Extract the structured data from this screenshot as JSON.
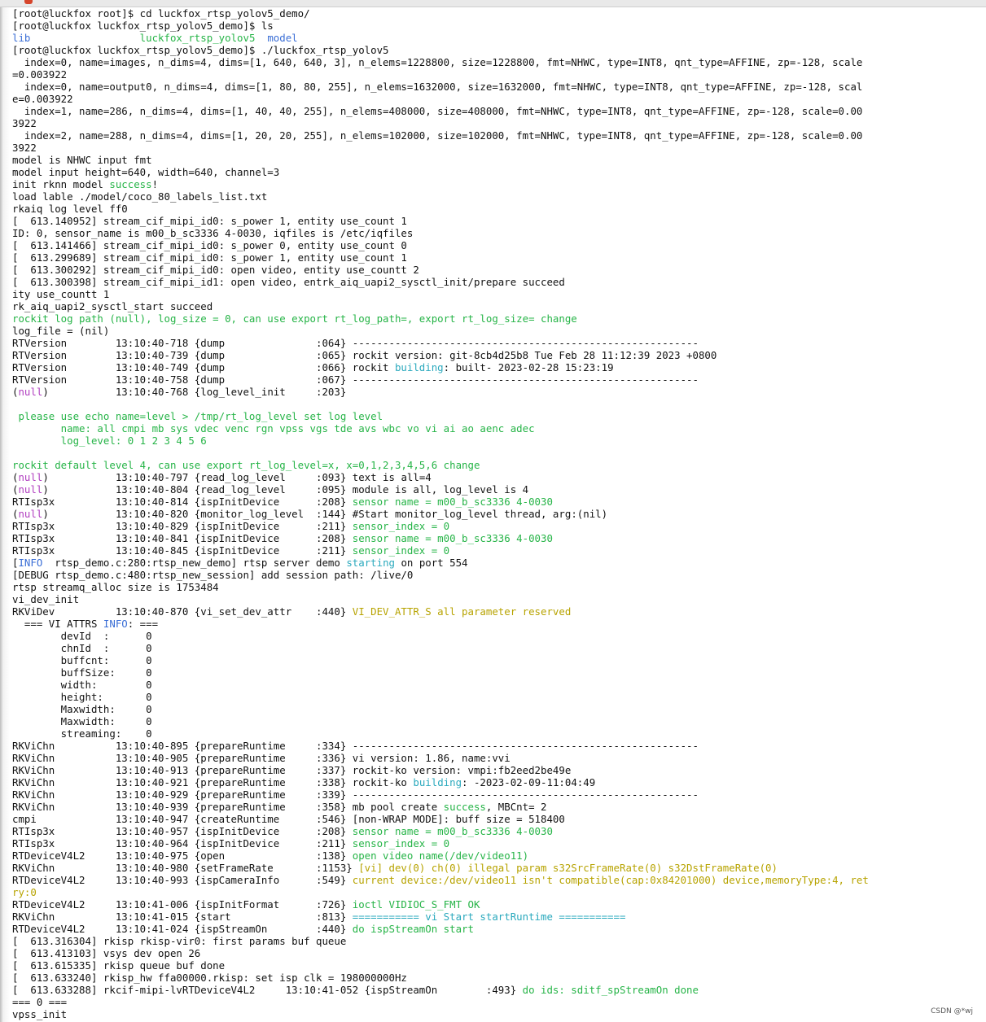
{
  "colors": {
    "cyan": "#2aa9bd",
    "green": "#26b447",
    "magenta": "#b13fc0",
    "yellow": "#b7a300",
    "blue": "#3a6ed6",
    "default": "#111111"
  },
  "terminal": {
    "lines": [
      [
        {
          "t": "[root@luckfox root]$ cd luckfox_rtsp_yolov5_demo/"
        }
      ],
      [
        {
          "t": "[root@luckfox luckfox_rtsp_yolov5_demo]$ ls"
        }
      ],
      [
        {
          "t": "lib",
          "c": "blue"
        },
        {
          "t": "                  "
        },
        {
          "t": "luckfox_rtsp_yolov5",
          "c": "green"
        },
        {
          "t": "  "
        },
        {
          "t": "model",
          "c": "blue"
        }
      ],
      [
        {
          "t": "[root@luckfox luckfox_rtsp_yolov5_demo]$ ./luckfox_rtsp_yolov5"
        }
      ],
      [
        {
          "t": "  index=0, name=images, n_dims=4, dims=[1, 640, 640, 3], n_elems=1228800, size=1228800, fmt=NHWC, type=INT8, qnt_type=AFFINE, zp=-128, scale"
        }
      ],
      [
        {
          "t": "=0.003922"
        }
      ],
      [
        {
          "t": "  index=0, name=output0, n_dims=4, dims=[1, 80, 80, 255], n_elems=1632000, size=1632000, fmt=NHWC, type=INT8, qnt_type=AFFINE, zp=-128, scal"
        }
      ],
      [
        {
          "t": "e=0.003922"
        }
      ],
      [
        {
          "t": "  index=1, name=286, n_dims=4, dims=[1, 40, 40, 255], n_elems=408000, size=408000, fmt=NHWC, type=INT8, qnt_type=AFFINE, zp=-128, scale=0.00"
        }
      ],
      [
        {
          "t": "3922"
        }
      ],
      [
        {
          "t": "  index=2, name=288, n_dims=4, dims=[1, 20, 20, 255], n_elems=102000, size=102000, fmt=NHWC, type=INT8, qnt_type=AFFINE, zp=-128, scale=0.00"
        }
      ],
      [
        {
          "t": "3922"
        }
      ],
      [
        {
          "t": "model is NHWC input fmt"
        }
      ],
      [
        {
          "t": "model input height=640, width=640, channel=3"
        }
      ],
      [
        {
          "t": "init rknn model "
        },
        {
          "t": "success",
          "c": "green"
        },
        {
          "t": "!"
        }
      ],
      [
        {
          "t": "load lable ./model/coco_80_labels_list.txt"
        }
      ],
      [
        {
          "t": "rkaiq log level ff0"
        }
      ],
      [
        {
          "t": "[  613.140952] stream_cif_mipi_id0: s_power 1, entity use_count 1"
        }
      ],
      [
        {
          "t": "ID: 0, sensor_name is m00_b_sc3336 4-0030, iqfiles is /etc/iqfiles"
        }
      ],
      [
        {
          "t": "[  613.141466] stream_cif_mipi_id0: s_power 0, entity use_count 0"
        }
      ],
      [
        {
          "t": "[  613.299689] stream_cif_mipi_id0: s_power 1, entity use_count 1"
        }
      ],
      [
        {
          "t": "[  613.300292] stream_cif_mipi_id0: open video, entity use_countt 2"
        }
      ],
      [
        {
          "t": "[  613.300398] stream_cif_mipi_id1: open video, entrk_aiq_uapi2_sysctl_init/prepare succeed"
        }
      ],
      [
        {
          "t": "ity use_countt 1"
        }
      ],
      [
        {
          "t": "rk_aiq_uapi2_sysctl_start succeed"
        }
      ],
      [
        {
          "t": "rockit log path (null), log_size = 0, can use export rt_log_path=, export rt_log_size= change",
          "c": "green"
        }
      ],
      [
        {
          "t": "log_file = (nil)"
        }
      ],
      [
        {
          "t": "RTVersion        13:10:40-718 {dump               :064} ---------------------------------------------------------"
        }
      ],
      [
        {
          "t": "RTVersion        13:10:40-739 {dump               :065} rockit version: git-8cb4d25b8 Tue Feb 28 11:12:39 2023 +0800"
        }
      ],
      [
        {
          "t": "RTVersion        13:10:40-749 {dump               :066} rockit "
        },
        {
          "t": "building",
          "c": "cyan"
        },
        {
          "t": ": built- 2023-02-28 15:23:19"
        }
      ],
      [
        {
          "t": "RTVersion        13:10:40-758 {dump               :067} ---------------------------------------------------------"
        }
      ],
      [
        {
          "t": "("
        },
        {
          "t": "null",
          "c": "magenta"
        },
        {
          "t": ")           13:10:40-768 {log_level_init     :203}"
        }
      ],
      [
        {
          "t": ""
        }
      ],
      [
        {
          "t": " please use echo name=level > /tmp/rt_log_level set log level",
          "c": "green"
        }
      ],
      [
        {
          "t": "        name: all cmpi mb sys vdec venc rgn vpss vgs tde avs wbc vo vi ai ao aenc adec",
          "c": "green"
        }
      ],
      [
        {
          "t": "        log_level: 0 1 2 3 4 5 6",
          "c": "green"
        }
      ],
      [
        {
          "t": ""
        }
      ],
      [
        {
          "t": "rockit default level 4, can use export rt_log_level=x, x=0,1,2,3,4,5,6 change",
          "c": "green"
        }
      ],
      [
        {
          "t": "("
        },
        {
          "t": "null",
          "c": "magenta"
        },
        {
          "t": ")           13:10:40-797 {read_log_level     :093} text is all=4"
        }
      ],
      [
        {
          "t": "("
        },
        {
          "t": "null",
          "c": "magenta"
        },
        {
          "t": ")           13:10:40-804 {read_log_level     :095} module is all, log_level is 4"
        }
      ],
      [
        {
          "t": "RTIsp3x          13:10:40-814 {ispInitDevice      :208} "
        },
        {
          "t": "sensor name = m00_b_sc3336 4-0030",
          "c": "green"
        }
      ],
      [
        {
          "t": "("
        },
        {
          "t": "null",
          "c": "magenta"
        },
        {
          "t": ")           13:10:40-820 {monitor_log_level  :144} #Start monitor_log_level thread, arg:(nil)"
        }
      ],
      [
        {
          "t": "RTIsp3x          13:10:40-829 {ispInitDevice      :211} "
        },
        {
          "t": "sensor_index = 0",
          "c": "green"
        }
      ],
      [
        {
          "t": "RTIsp3x          13:10:40-841 {ispInitDevice      :208} "
        },
        {
          "t": "sensor name = m00_b_sc3336 4-0030",
          "c": "green"
        }
      ],
      [
        {
          "t": "RTIsp3x          13:10:40-845 {ispInitDevice      :211} "
        },
        {
          "t": "sensor_index = 0",
          "c": "green"
        }
      ],
      [
        {
          "t": "["
        },
        {
          "t": "INFO",
          "c": "blue"
        },
        {
          "t": "  rtsp_demo.c:280:rtsp_new_demo] rtsp server demo "
        },
        {
          "t": "starting",
          "c": "cyan"
        },
        {
          "t": " on port 554"
        }
      ],
      [
        {
          "t": "[DEBUG rtsp_demo.c:480:rtsp_new_session] add session path: /live/0"
        }
      ],
      [
        {
          "t": "rtsp streamq_alloc size is 1753484"
        }
      ],
      [
        {
          "t": "vi_dev_init"
        }
      ],
      [
        {
          "t": "RKViDev          13:10:40-870 {vi_set_dev_attr    :440} "
        },
        {
          "t": "VI_DEV_ATTR_S all parameter reserved",
          "c": "yellow"
        }
      ],
      [
        {
          "t": "  === VI ATTRS "
        },
        {
          "t": "INFO",
          "c": "blue"
        },
        {
          "t": ": ==="
        }
      ],
      [
        {
          "t": "        devId  :      0"
        }
      ],
      [
        {
          "t": "        chnId  :      0"
        }
      ],
      [
        {
          "t": "        buffcnt:      0"
        }
      ],
      [
        {
          "t": "        buffSize:     0"
        }
      ],
      [
        {
          "t": "        width:        0"
        }
      ],
      [
        {
          "t": "        height:       0"
        }
      ],
      [
        {
          "t": "        Maxwidth:     0"
        }
      ],
      [
        {
          "t": "        Maxwidth:     0"
        }
      ],
      [
        {
          "t": "        streaming:    0"
        }
      ],
      [
        {
          "t": "RKViChn          13:10:40-895 {prepareRuntime     :334} ---------------------------------------------------------"
        }
      ],
      [
        {
          "t": "RKViChn          13:10:40-905 {prepareRuntime     :336} vi version: 1.86, name:vvi"
        }
      ],
      [
        {
          "t": "RKViChn          13:10:40-913 {prepareRuntime     :337} rockit-ko version: vmpi:fb2eed2be49e"
        }
      ],
      [
        {
          "t": "RKViChn          13:10:40-921 {prepareRuntime     :338} rockit-ko "
        },
        {
          "t": "building",
          "c": "cyan"
        },
        {
          "t": ": -2023-02-09-11:04:49"
        }
      ],
      [
        {
          "t": "RKViChn          13:10:40-929 {prepareRuntime     :339} ---------------------------------------------------------"
        }
      ],
      [
        {
          "t": "RKViChn          13:10:40-939 {prepareRuntime     :358} mb pool create "
        },
        {
          "t": "success",
          "c": "green"
        },
        {
          "t": ", MBCnt= 2"
        }
      ],
      [
        {
          "t": "cmpi             13:10:40-947 {createRuntime      :546} [non-WRAP MODE]: buff size = 518400"
        }
      ],
      [
        {
          "t": "RTIsp3x          13:10:40-957 {ispInitDevice      :208} "
        },
        {
          "t": "sensor name = m00_b_sc3336 4-0030",
          "c": "green"
        }
      ],
      [
        {
          "t": "RTIsp3x          13:10:40-964 {ispInitDevice      :211} "
        },
        {
          "t": "sensor_index = 0",
          "c": "green"
        }
      ],
      [
        {
          "t": "RTDeviceV4L2     13:10:40-975 {open               :138} "
        },
        {
          "t": "open video name(/dev/video11)",
          "c": "green"
        }
      ],
      [
        {
          "t": "RKViChn          13:10:40-980 {setFrameRate       :1153} "
        },
        {
          "t": "[vi] dev(0) ch(0) illegal param s32SrcFrameRate(0) s32DstFrameRate(0)",
          "c": "yellow"
        }
      ],
      [
        {
          "t": "RTDeviceV4L2     13:10:40-993 {ispCameraInfo      :549} "
        },
        {
          "t": "current device:/dev/video11 isn't compatible(cap:0x84201000) device,memoryType:4, ret",
          "c": "yellow"
        }
      ],
      [
        {
          "t": "ry:0",
          "c": "yellow"
        }
      ],
      [
        {
          "t": "RTDeviceV4L2     13:10:41-006 {ispInitFormat      :726} "
        },
        {
          "t": "ioctl VIDIOC_S_FMT OK",
          "c": "green"
        }
      ],
      [
        {
          "t": "RKViChn          13:10:41-015 {start              :813} "
        },
        {
          "t": "=========== vi Start startRuntime ===========",
          "c": "cyan"
        }
      ],
      [
        {
          "t": "RTDeviceV4L2     13:10:41-024 {ispStreamOn        :440} "
        },
        {
          "t": "do ispStreamOn start",
          "c": "green"
        }
      ],
      [
        {
          "t": "[  613.316304] rkisp rkisp-vir0: first params buf queue"
        }
      ],
      [
        {
          "t": "[  613.413103] vsys dev open 26"
        }
      ],
      [
        {
          "t": "[  613.615335] rkisp queue buf done"
        }
      ],
      [
        {
          "t": "[  613.633240] rkisp_hw ffa00000.rkisp: set isp clk = 198000000Hz"
        }
      ],
      [
        {
          "t": "[  613.633288] rkcif-mipi-lvRTDeviceV4L2     13:10:41-052 {ispStreamOn        :493} "
        },
        {
          "t": "do ids: sditf_spStreamOn done",
          "c": "green"
        }
      ],
      [
        {
          "t": "=== 0 ==="
        }
      ],
      [
        {
          "t": "vpss_init"
        }
      ]
    ]
  },
  "watermark": "CSDN @*wj"
}
